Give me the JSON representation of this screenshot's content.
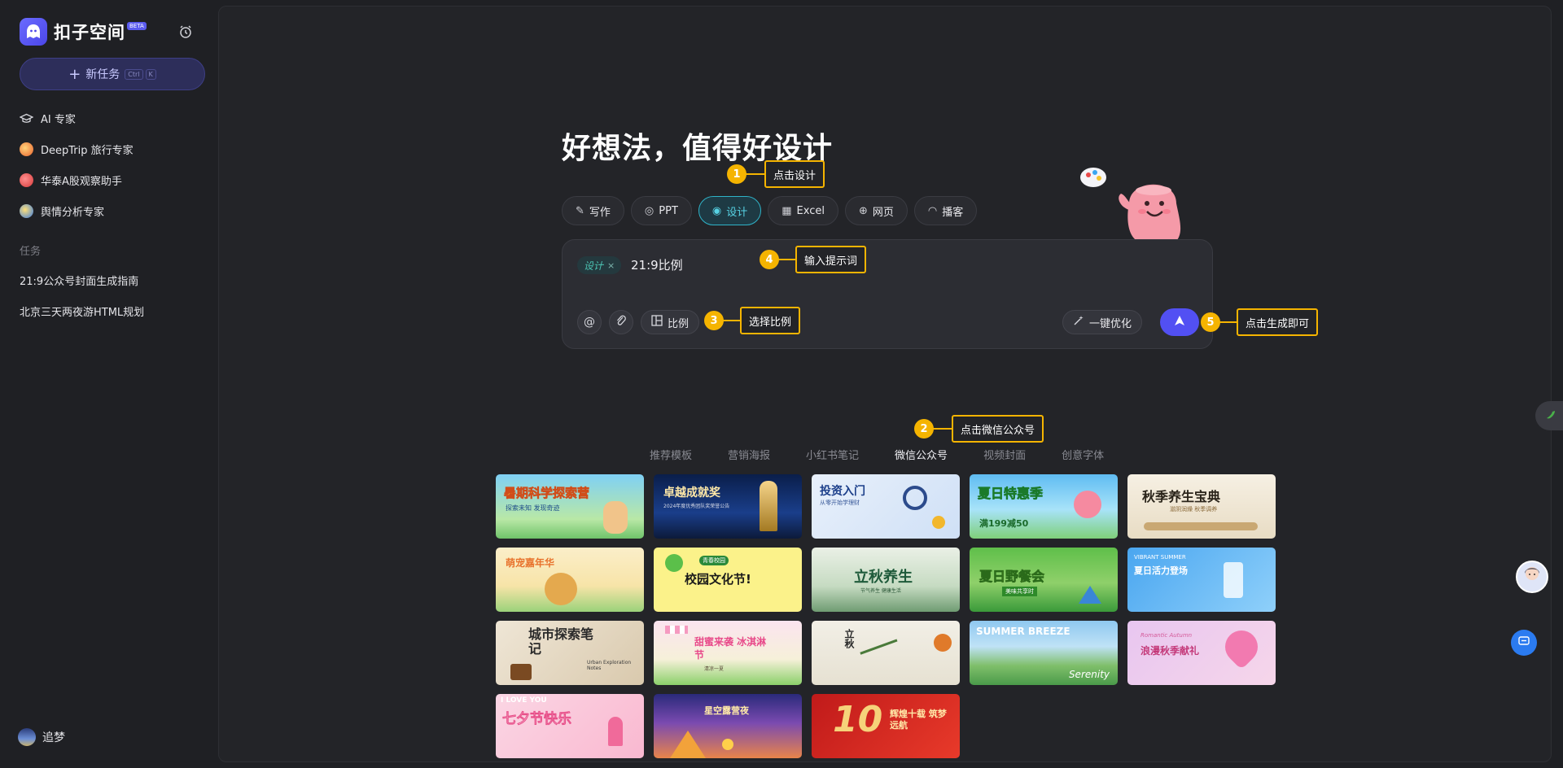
{
  "sidebar": {
    "app_name": "扣子空间",
    "beta_label": "BETA",
    "new_task_label": "新任务",
    "new_task_shortcut": [
      "Ctrl",
      "K"
    ],
    "experts": [
      {
        "label": "AI 专家",
        "icon": "graduation-cap-icon"
      },
      {
        "label": "DeepTrip 旅行专家",
        "icon": "deeptrip-icon"
      },
      {
        "label": "华泰A股观察助手",
        "icon": "huatai-icon"
      },
      {
        "label": "舆情分析专家",
        "icon": "sentiment-icon"
      }
    ],
    "tasks_section_label": "任务",
    "tasks": [
      {
        "label": "21:9公众号封面生成指南"
      },
      {
        "label": "北京三天两夜游HTML规划"
      }
    ],
    "user_name": "追梦"
  },
  "main": {
    "headline": "好想法，值得好设计",
    "mode_tabs": [
      {
        "label": "写作",
        "icon": "pen-icon",
        "active": false
      },
      {
        "label": "PPT",
        "icon": "ppt-icon",
        "active": false
      },
      {
        "label": "设计",
        "icon": "palette-icon",
        "active": true
      },
      {
        "label": "Excel",
        "icon": "table-icon",
        "active": false
      },
      {
        "label": "网页",
        "icon": "globe-icon",
        "active": false
      },
      {
        "label": "播客",
        "icon": "podcast-icon",
        "active": false
      }
    ],
    "input": {
      "chip_label": "设计",
      "chip_close": "×",
      "prompt_text": "21:9比例",
      "at_symbol": "@",
      "ratio_label": "比例",
      "optimize_label": "一键优化"
    },
    "template_categories": [
      {
        "label": "推荐模板",
        "active": false
      },
      {
        "label": "营销海报",
        "active": false
      },
      {
        "label": "小红书笔记",
        "active": false
      },
      {
        "label": "微信公众号",
        "active": true
      },
      {
        "label": "视频封面",
        "active": false
      },
      {
        "label": "创意字体",
        "active": false
      }
    ],
    "templates": [
      {
        "title": "暑期科学探索营",
        "sub": "探索未知 发现奇迹"
      },
      {
        "title": "卓越成就奖",
        "sub": "2024年度优秀团队奖荣誉公告"
      },
      {
        "title": "投资入门",
        "sub": "从零开始学理财"
      },
      {
        "title": "夏日特惠季",
        "sub": "满199减50"
      },
      {
        "title": "秋季养生宝典",
        "sub": "滋阴润燥 秋季调养"
      },
      {
        "title": "萌宠嘉年华",
        "sub": ""
      },
      {
        "title": "校园文化节!",
        "sub": "青春校园"
      },
      {
        "title": "立秋养生",
        "sub": "节气养生 健康生活"
      },
      {
        "title": "夏日野餐会",
        "sub": "美味共享时"
      },
      {
        "title": "夏日活力登场",
        "sub": "VIBRANT SUMMER"
      },
      {
        "title": "城市探索笔记",
        "sub": "Urban Exploration Notes"
      },
      {
        "title": "甜蜜来袭 冰淇淋节",
        "sub": "清凉一夏"
      },
      {
        "title": "立秋",
        "sub": ""
      },
      {
        "title": "SUMMER BREEZE",
        "sub": "Serenity"
      },
      {
        "title": "浪漫秋季献礼",
        "sub": "Romantic Autumn"
      },
      {
        "title": "七夕节快乐",
        "sub": "I LOVE YOU"
      },
      {
        "title": "星空露营夜",
        "sub": ""
      },
      {
        "title": "辉煌十载 筑梦远航",
        "sub": "10"
      }
    ]
  },
  "annotations": [
    {
      "num": "1",
      "label": "点击设计"
    },
    {
      "num": "2",
      "label": "点击微信公众号"
    },
    {
      "num": "3",
      "label": "选择比例"
    },
    {
      "num": "4",
      "label": "输入提示词"
    },
    {
      "num": "5",
      "label": "点击生成即可"
    }
  ],
  "colors": {
    "accent": "#5250f3",
    "active_tab": "#57d3e4",
    "annotation": "#f5b400",
    "background": "#1f2024"
  }
}
